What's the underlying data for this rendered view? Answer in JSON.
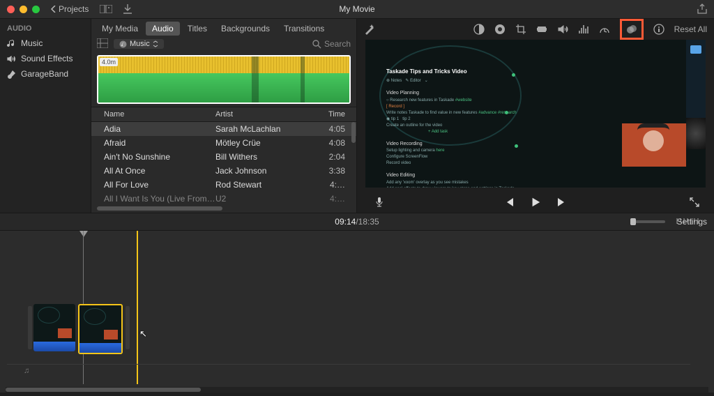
{
  "titlebar": {
    "title": "My Movie",
    "back": "Projects"
  },
  "sidebar": {
    "heading": "AUDIO",
    "items": [
      {
        "label": "Music"
      },
      {
        "label": "Sound Effects"
      },
      {
        "label": "GarageBand"
      }
    ]
  },
  "tabs": [
    {
      "label": "My Media"
    },
    {
      "label": "Audio"
    },
    {
      "label": "Titles"
    },
    {
      "label": "Backgrounds"
    },
    {
      "label": "Transitions"
    }
  ],
  "active_tab": 1,
  "browser": {
    "source": "Music",
    "search_placeholder": "Search",
    "waveform_badge": "4.0m",
    "columns": {
      "name": "Name",
      "artist": "Artist",
      "time": "Time"
    },
    "tracks": [
      {
        "name": "Adia",
        "artist": "Sarah McLachlan",
        "time": "4:05",
        "selected": true
      },
      {
        "name": "Afraid",
        "artist": "Mötley Crüe",
        "time": "4:08"
      },
      {
        "name": "Ain't No Sunshine",
        "artist": "Bill Withers",
        "time": "2:04"
      },
      {
        "name": "All At Once",
        "artist": "Jack Johnson",
        "time": "3:38"
      },
      {
        "name": "All For Love",
        "artist": "Rod Stewart",
        "time": "4:…"
      },
      {
        "name": "All I Want Is You (Live From…",
        "artist": "U2",
        "time": "4:…"
      }
    ]
  },
  "inspector": {
    "reset": "Reset All"
  },
  "preview": {
    "doc_title": "Taskade Tips and Tricks Video",
    "sections": {
      "planning": "Video Planning",
      "recording": "Video Recording",
      "editing": "Video Editing"
    }
  },
  "timecode": {
    "current": "09:14",
    "sep": " / ",
    "total": "18:35"
  },
  "settings_label": "Settings"
}
